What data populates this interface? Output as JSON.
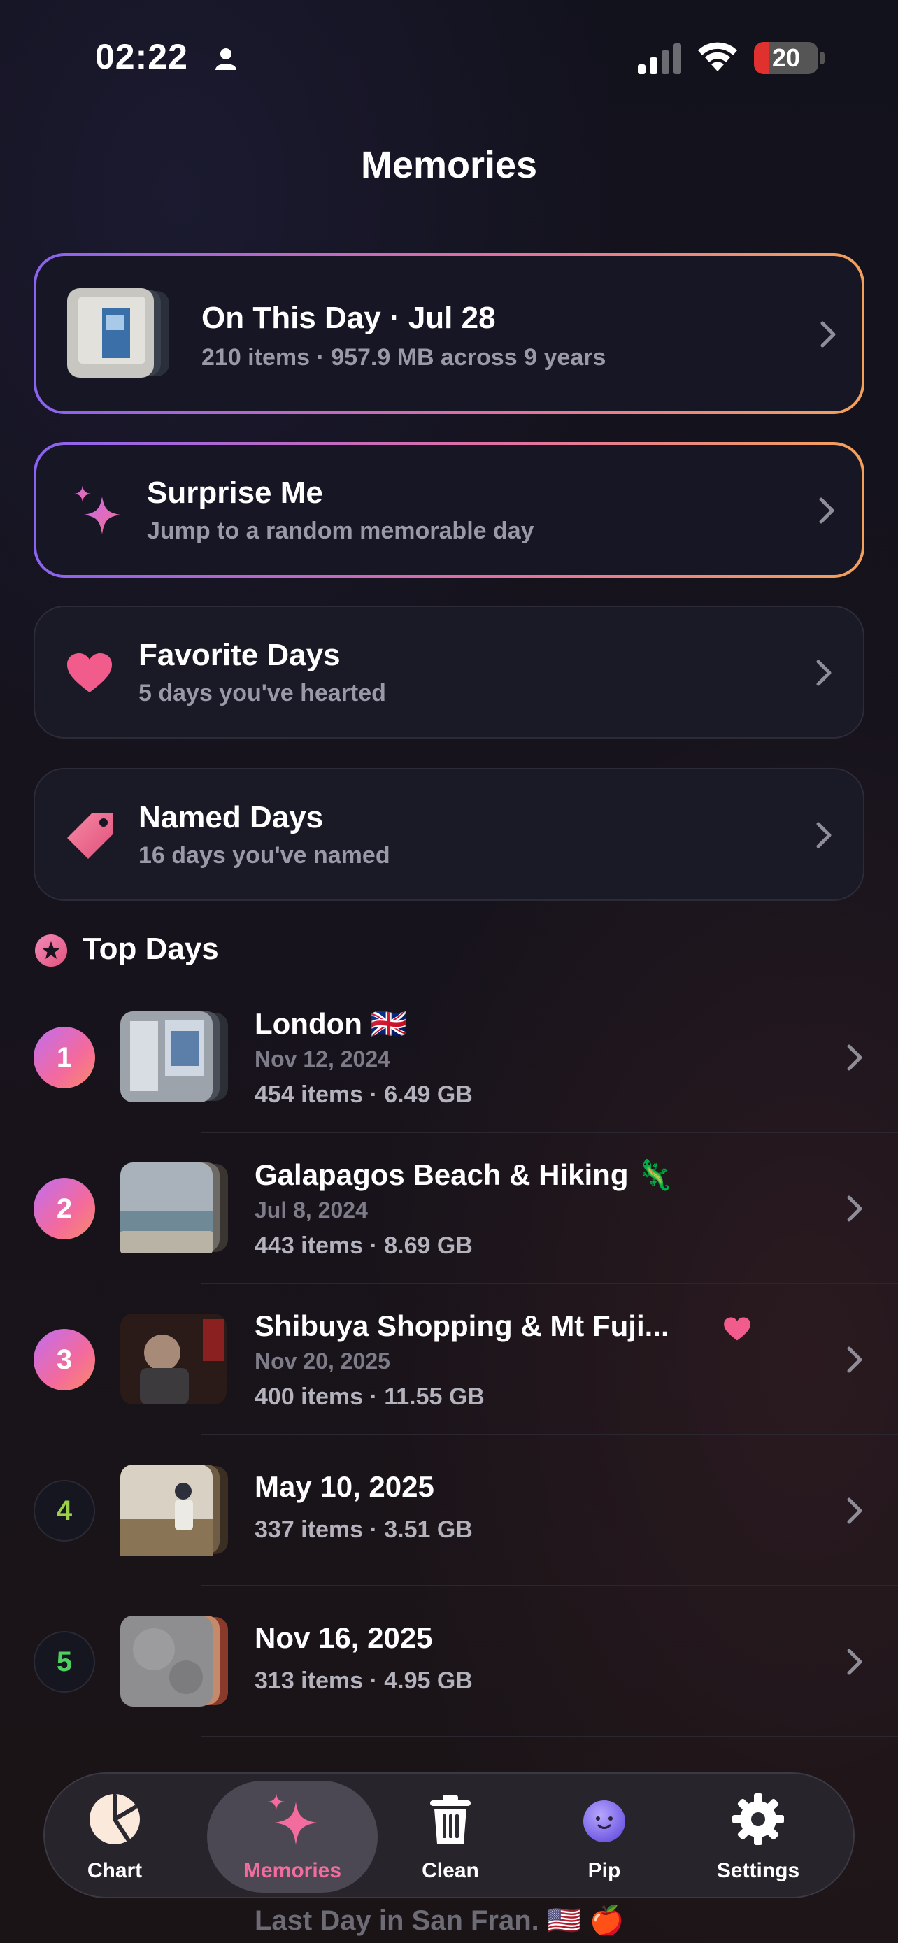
{
  "status_bar": {
    "time": "02:22",
    "battery": "20"
  },
  "header": {
    "title": "Memories"
  },
  "cards": {
    "on_this_day": {
      "title": "On This Day · Jul 28",
      "subtitle": "210 items · 957.9 MB across 9 years"
    },
    "surprise": {
      "title": "Surprise Me",
      "subtitle": "Jump to a random memorable day"
    },
    "favorites": {
      "title": "Favorite Days",
      "subtitle": "5 days you've hearted"
    },
    "named": {
      "title": "Named Days",
      "subtitle": "16 days you've named"
    }
  },
  "top_days": {
    "label": "Top Days",
    "items": [
      {
        "rank": "1",
        "title": "London 🇬🇧",
        "date": "Nov 12, 2024",
        "meta": "454 items · 6.49 GB"
      },
      {
        "rank": "2",
        "title": "Galapagos Beach & Hiking 🦎",
        "date": "Jul 8, 2024",
        "meta": "443 items · 8.69 GB"
      },
      {
        "rank": "3",
        "title": "Shibuya Shopping & Mt Fuji...",
        "date": "Nov 20, 2025",
        "meta": "400 items · 11.55 GB"
      },
      {
        "rank": "4",
        "title": "May 10, 2025",
        "date": "",
        "meta": "337 items · 3.51 GB"
      },
      {
        "rank": "5",
        "title": "Nov 16, 2025",
        "date": "",
        "meta": "313 items · 4.95 GB"
      }
    ],
    "partial_last": "Last Day in San Fran. 🇺🇸 🍎"
  },
  "tabbar": {
    "tabs": [
      {
        "label": "Chart"
      },
      {
        "label": "Memories"
      },
      {
        "label": "Clean"
      },
      {
        "label": "Pip"
      },
      {
        "label": "Settings"
      }
    ],
    "active_color": "#f26d9e"
  }
}
